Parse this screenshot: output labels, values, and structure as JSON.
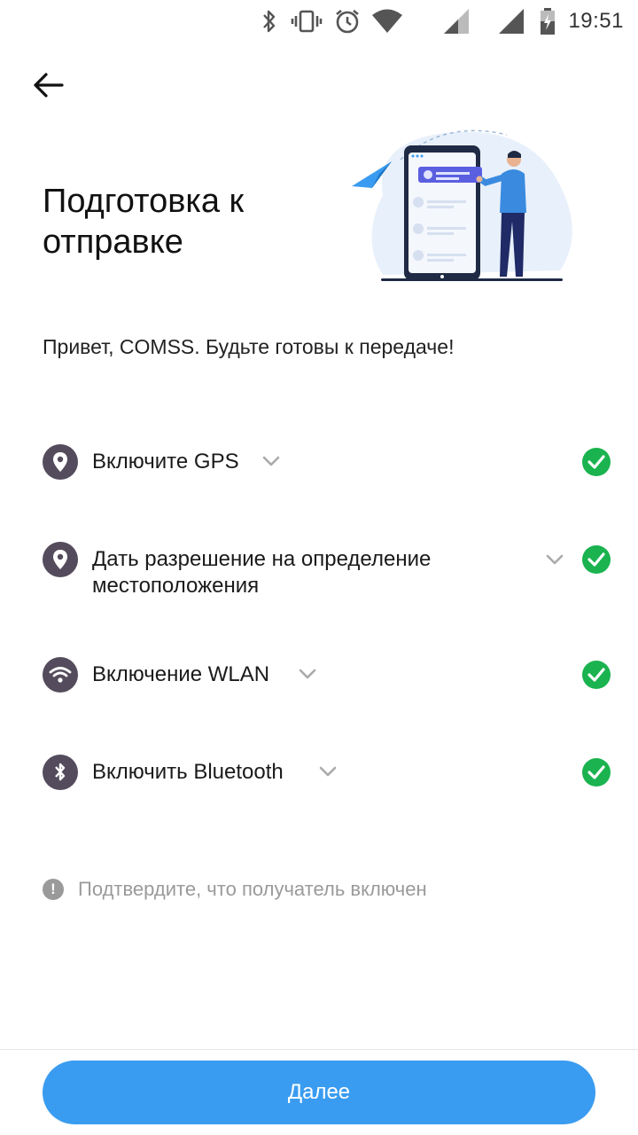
{
  "status_bar": {
    "time": "19:51",
    "icons": [
      "bluetooth-icon",
      "vibrate-icon",
      "alarm-icon",
      "wifi-icon",
      "signal-icon",
      "signal-icon",
      "battery-icon"
    ]
  },
  "header": {
    "title": "Подготовка к отправке"
  },
  "greeting": "Привет, COMSS. Будьте готовы к передаче!",
  "checklist": [
    {
      "label": "Включите GPS",
      "icon": "location-pin-icon",
      "done": true
    },
    {
      "label": "Дать разрешение на определение местоположения",
      "icon": "location-pin-icon",
      "done": true
    },
    {
      "label": "Включение WLAN",
      "icon": "wifi-icon",
      "done": true
    },
    {
      "label": "Включить Bluetooth",
      "icon": "bluetooth-icon",
      "done": true
    }
  ],
  "note": "Подтвердите, что получатель включен",
  "next_button_label": "Далее",
  "colors": {
    "accent": "#3a9cf0",
    "check": "#1ab34f",
    "row_icon_bg": "#544c5c"
  }
}
